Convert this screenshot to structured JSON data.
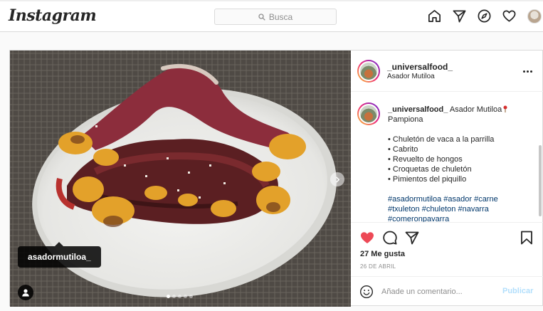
{
  "nav": {
    "logo": "Instagram",
    "search_placeholder": "Busca",
    "icons": [
      "home-icon",
      "direct-icon",
      "explore-icon",
      "activity-heart-icon",
      "profile-avatar"
    ]
  },
  "post": {
    "username": "_universalfood_",
    "location": "Asador Mutiloa",
    "tag_label": "asadormutiloa_",
    "carousel": {
      "total": 5,
      "current": 1
    },
    "caption": {
      "username": "_universalfood_",
      "line1": "Asador Mutiloa",
      "line2": "Pampiona",
      "items": [
        "• Chuletón de vaca a la parrilla",
        "• Cabrito",
        "• Revuelto de hongos",
        "• Croquetas de chuletón",
        "• Pimientos del piquillo"
      ],
      "hashtags_1": "#asadormutiloa #asador #carne",
      "hashtags_2": "#txuleton #chuleton #navarra",
      "hashtags_3": "#comeronpavarra"
    },
    "likes": "27 Me gusta",
    "date": "26 DE ABRIL",
    "liked": true,
    "comment_placeholder": "Añade un comentario...",
    "publish_label": "Publicar"
  },
  "colors": {
    "like_red": "#ed4956",
    "publish_disabled": "#b2dffc",
    "hashtag": "#00376b",
    "border": "#dbdbdb"
  }
}
